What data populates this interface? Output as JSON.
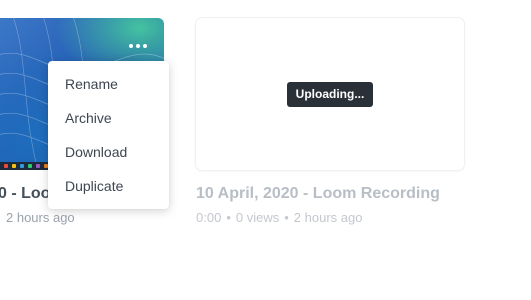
{
  "cards": [
    {
      "title": "0 - Loo",
      "meta_tail": "2 hours ago",
      "more_icon": "more-horizontal-icon",
      "menu": {
        "items": [
          "Rename",
          "Archive",
          "Download",
          "Duplicate"
        ]
      }
    },
    {
      "title": "10 April, 2020 - Loom Recording",
      "status_badge": "Uploading...",
      "duration": "0:00",
      "views": "0 views",
      "age": "2 hours ago",
      "separator": "•"
    }
  ],
  "colors": {
    "title_dark": "#46505a",
    "meta_gray": "#9aa2ad",
    "badge_bg": "#2a3038",
    "muted_title": "#b8bec6"
  }
}
